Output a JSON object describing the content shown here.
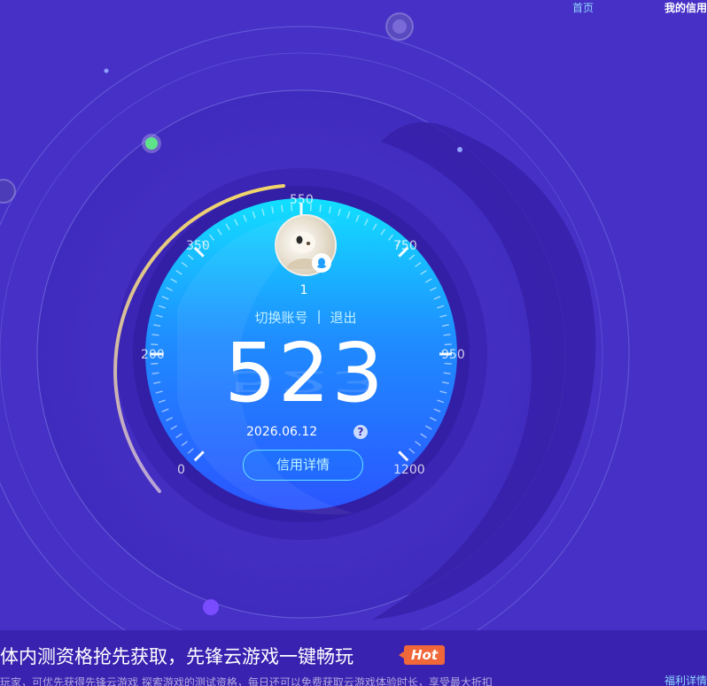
{
  "nav": {
    "home": "首页",
    "credit": "我的信用"
  },
  "gauge": {
    "ticks": [
      {
        "value": "0"
      },
      {
        "value": "200"
      },
      {
        "value": "350"
      },
      {
        "value": "550"
      },
      {
        "value": "750"
      },
      {
        "value": "950"
      },
      {
        "value": "1200"
      }
    ],
    "progress_value": 523,
    "max_value": 1200
  },
  "user": {
    "name": "1"
  },
  "account": {
    "switch": "切换账号",
    "separator": "|",
    "logout": "退出"
  },
  "score": "523",
  "date": "2026.06.12",
  "help": "?",
  "detail_button": "信用详情",
  "banner": {
    "title": "体内测资格抢先获取，先锋云游戏一键畅玩",
    "badge": "Hot",
    "subtitle": "玩家，可优先获得先锋云游戏 探索游戏的测试资格，每日还可以免费获取云游戏体验时长，享受最大折扣",
    "welfare": "福利详情"
  },
  "colors": {
    "accent": "#00c8ff",
    "gold": "#e6c15a",
    "hot": "#f0683a"
  }
}
